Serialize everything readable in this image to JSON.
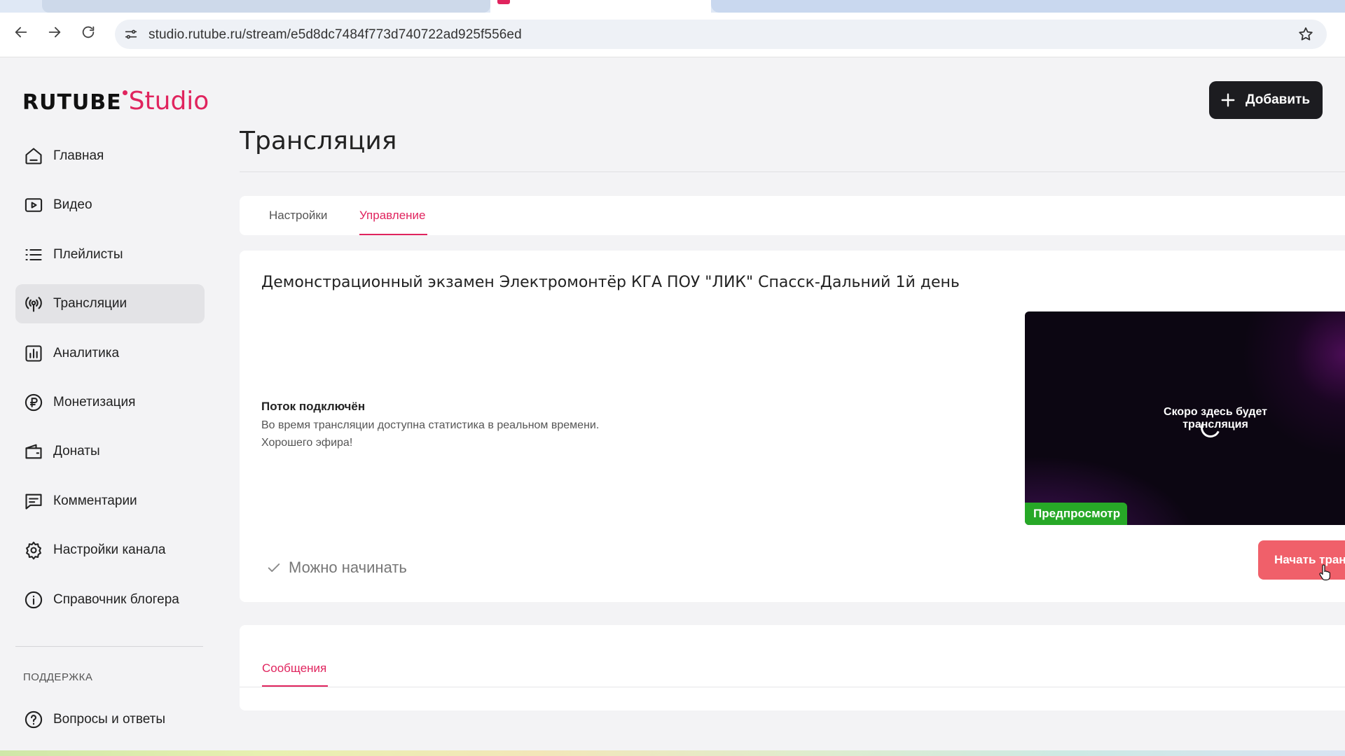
{
  "browser": {
    "url": "studio.rutube.ru/stream/e5d8dc7484f773d740722ad925f556ed",
    "nav": {
      "back_icon": "arrow-left-icon",
      "forward_icon": "arrow-right-icon",
      "reload_icon": "reload-icon"
    }
  },
  "header": {
    "logo_main": "RUTUBE",
    "logo_sub": "Studio",
    "add_button": "Добавить"
  },
  "sidebar": {
    "items": [
      {
        "label": "Главная",
        "icon": "home-icon"
      },
      {
        "label": "Видео",
        "icon": "video-icon"
      },
      {
        "label": "Плейлисты",
        "icon": "list-icon"
      },
      {
        "label": "Трансляции",
        "icon": "broadcast-icon",
        "active": true
      },
      {
        "label": "Аналитика",
        "icon": "chart-icon"
      },
      {
        "label": "Монетизация",
        "icon": "ruble-icon"
      },
      {
        "label": "Донаты",
        "icon": "wallet-icon"
      },
      {
        "label": "Комментарии",
        "icon": "comment-icon"
      },
      {
        "label": "Настройки канала",
        "icon": "gear-icon"
      },
      {
        "label": "Справочник блогера",
        "icon": "info-icon"
      }
    ],
    "support_label": "ПОДДЕРЖКА",
    "faq_label": "Вопросы и ответы"
  },
  "main": {
    "page_title": "Трансляция",
    "tabs": [
      {
        "label": "Настройки"
      },
      {
        "label": "Управление",
        "active": true
      }
    ],
    "stream_title": "Демонстрационный экзамен Электромонтёр КГА ПОУ \"ЛИК\" Спасск-Дальний 1й день",
    "status": {
      "heading": "Поток подключён",
      "line1": "Во время трансляции доступна статистика в реальном времени.",
      "line2": "Хорошего эфира!"
    },
    "preview": {
      "placeholder": "Скоро здесь будет трансляция",
      "badge": "Предпросмотр"
    },
    "ready_label": "Можно начинать",
    "start_button": "Начать трансляцию",
    "messages_tab": "Сообщения"
  },
  "colors": {
    "accent": "#e0245e",
    "start_button": "#f0606a",
    "preview_badge": "#27a827",
    "add_button": "#1c1c20"
  }
}
